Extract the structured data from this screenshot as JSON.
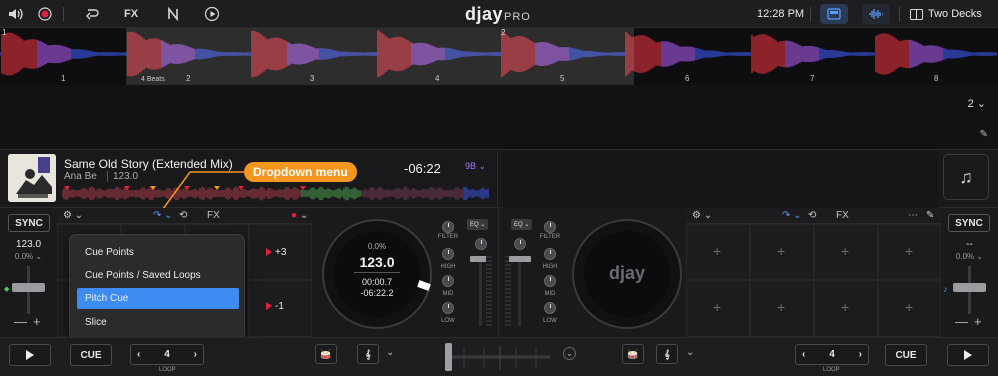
{
  "app": {
    "logo": "djay",
    "logo_suffix": "PRO",
    "clock": "12:28 PM",
    "layout_label": "Two Decks",
    "toolbar_fx": "FX"
  },
  "overview": {
    "beat_numbers": [
      "1",
      "2",
      "3",
      "4",
      "5",
      "6",
      "7",
      "8"
    ],
    "cue_markers": [
      "1",
      "2"
    ],
    "loop_label": "4 Beats",
    "colors": {
      "low": "#e0303c",
      "mid": "#a858e8",
      "high": "#3c56f0"
    }
  },
  "side_panel": {
    "deck_number": "2"
  },
  "track": {
    "title": "Same Old Story (Extended Mix)",
    "artist": "Ana Be",
    "bpm": "123.0",
    "remaining": "-06:22",
    "key": "9B"
  },
  "callout": {
    "label": "Dropdown menu"
  },
  "deck_left": {
    "fx_label": "FX",
    "sync": "SYNC",
    "bpm": "123.0",
    "pitch": "0.0%",
    "minus": "—",
    "plus": "+",
    "pads": [
      {
        "label": "+3"
      },
      {
        "label": "-1"
      }
    ],
    "dropdown": {
      "items": [
        "Cue Points",
        "Cue Points / Saved Loops",
        "Pitch Cue",
        "Slice"
      ],
      "selected": "Pitch Cue"
    },
    "jog": {
      "pitch": "0.0%",
      "bpm": "123.0",
      "elapsed": "00:00.7",
      "remaining": "-06:22.2"
    },
    "cue": "CUE",
    "loop_value": "4",
    "loop_label": "LOOP"
  },
  "deck_right": {
    "fx_label": "FX",
    "sync": "SYNC",
    "bpm": "--",
    "pitch": "0.0%",
    "minus": "—",
    "plus": "+",
    "jog_logo": "djay",
    "cue": "CUE",
    "loop_value": "4",
    "loop_label": "LOOP"
  },
  "mixer": {
    "eq_label": "EQ",
    "knobs": [
      "FILTER",
      "HIGH",
      "MID",
      "LOW"
    ]
  },
  "accent": "#3d8cf2",
  "orange": "#f3961e"
}
